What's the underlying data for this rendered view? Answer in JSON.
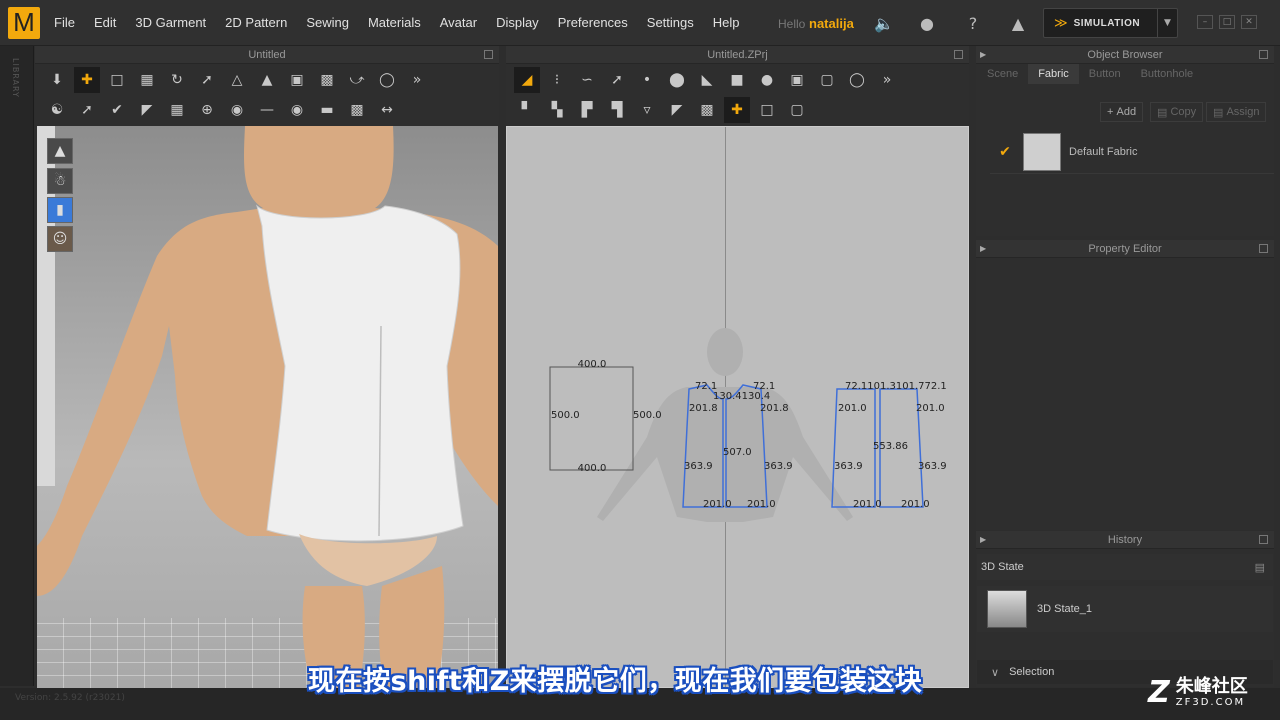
{
  "app": {
    "logo_letter": "M",
    "menu": [
      "File",
      "Edit",
      "3D Garment",
      "2D Pattern",
      "Sewing",
      "Materials",
      "Avatar",
      "Display",
      "Preferences",
      "Settings",
      "Help"
    ],
    "hello_label": "Hello",
    "username": "natalija",
    "simulation_label": "SIMULATION",
    "accent_color": "#f2a90d"
  },
  "left_strip": {
    "label": "LIBRARY"
  },
  "viewport3d": {
    "title": "Untitled"
  },
  "viewport2d": {
    "title": "Untitled.ZPrj",
    "labels": {
      "rect_top": "400.0",
      "rect_bottom": "400.0",
      "rect_left": "500.0",
      "rect_right": "500.0",
      "front_shoulder_l": "72.1",
      "front_shoulder_r": "72.1",
      "front_neck": "130.4130.4",
      "front_arm_l": "201.8",
      "front_arm_r": "201.8",
      "front_side_l": "363.9",
      "front_side_r": "363.9",
      "front_center": "507.0",
      "front_hem_l": "201.0",
      "front_hem_r": "201.0",
      "back_shoulder": "72.1101.3101.772.1",
      "back_arm_l": "201.0",
      "back_arm_r": "201.0",
      "back_side_l": "363.9",
      "back_side_r": "363.9",
      "back_center": "553.86",
      "back_hem_l": "201.0",
      "back_hem_r": "201.0"
    }
  },
  "object_browser": {
    "title": "Object Browser",
    "tabs": [
      "Scene",
      "Fabric",
      "Button",
      "Buttonhole"
    ],
    "active_tab": "Fabric",
    "add_label": "Add",
    "copy_label": "Copy",
    "assign_label": "Assign",
    "fabric_name": "Default Fabric"
  },
  "property_editor": {
    "title": "Property Editor"
  },
  "history": {
    "title": "History",
    "state_label": "3D State",
    "item_label": "3D State_1",
    "selection_label": "Selection"
  },
  "status": {
    "version": "Version: 2.5.92 (r23021)"
  },
  "subtitle": "现在按shift和Z来摆脱它们，现在我们要包装这块",
  "watermark": {
    "line1": "朱峰社区",
    "line2": "ZF3D.COM"
  }
}
